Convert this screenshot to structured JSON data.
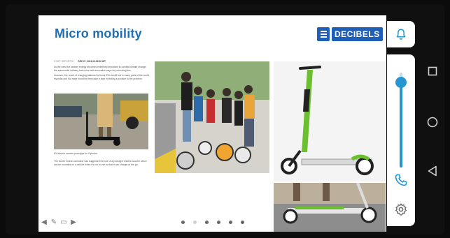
{
  "slide": {
    "title": "Micro mobility",
    "brand": "DECIBELS",
    "article": {
      "meta_left": "STAFF REPORTER",
      "meta_date": "DEC 27, 2019 00:00:00 IST",
      "paragraphs": [
        "As the need for cleaner energy becomes extremely important to combat climate change, the automobile industry has come with innovative ways for promoting this.",
        "However, the reach of charging stations for these EVs is still low in many parts of the world. Hyundai and Kia have found the best take a step in finding a solution to the problem."
      ],
      "caption": "EV electric scooter prototype for Hyundai.",
      "body_after": "The South Korean carmaker has suggested the use of a prototype electric scooter which can be mounted on a vehicle when it's not in use so that it can charge on the go."
    },
    "pagination": {
      "count": 6,
      "active_index": 1
    },
    "tools": [
      "arrow-left-icon",
      "pen-icon",
      "screen-icon",
      "arrow-right-icon"
    ]
  },
  "side_panel": {
    "volume_level": 0.9,
    "icons": [
      "bell-icon",
      "phone-icon",
      "gear-icon"
    ]
  },
  "nav_bar": {
    "buttons": [
      "recent-apps",
      "home",
      "back"
    ]
  },
  "colors": {
    "title": "#1f6fb5",
    "brand": "#1f5fb8",
    "accent": "#2596d0",
    "scooter_green": "#6cbf2f"
  }
}
